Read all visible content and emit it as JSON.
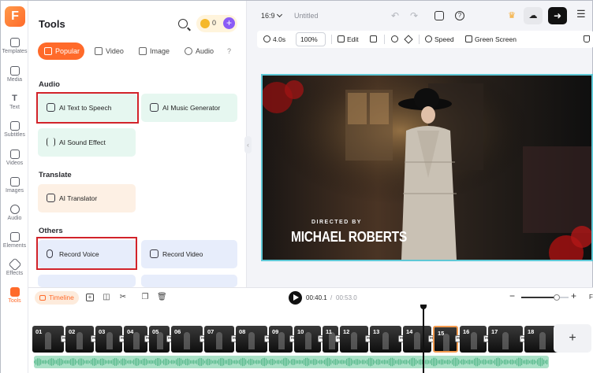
{
  "rail": {
    "logo": "F",
    "items": [
      {
        "label": "Templates",
        "icon": "templates-icon"
      },
      {
        "label": "Media",
        "icon": "media-icon"
      },
      {
        "label": "Text",
        "icon": "text-icon"
      },
      {
        "label": "Subtitles",
        "icon": "subtitles-icon"
      },
      {
        "label": "Videos",
        "icon": "videos-icon"
      },
      {
        "label": "Images",
        "icon": "images-icon"
      },
      {
        "label": "Audio",
        "icon": "audio-icon"
      },
      {
        "label": "Elements",
        "icon": "elements-icon"
      },
      {
        "label": "Effects",
        "icon": "effects-icon"
      },
      {
        "label": "Tools",
        "icon": "tools-icon",
        "active": true
      }
    ]
  },
  "panel": {
    "title": "Tools",
    "credits": "0",
    "tabs": [
      "Popular",
      "Video",
      "Image",
      "Audio",
      "?"
    ],
    "sections": {
      "audio": "Audio",
      "translate": "Translate",
      "others": "Others"
    },
    "cards": {
      "ai_tts": "AI Text to Speech",
      "ai_music": "AI Music Generator",
      "ai_sfx": "AI Sound Effect",
      "ai_translator": "AI Translator",
      "record_voice": "Record Voice",
      "record_video": "Record Video"
    }
  },
  "topbar": {
    "ratio": "16:9",
    "title": "Untitled"
  },
  "edit_toolbar": {
    "duration": "4.0s",
    "zoom": "100%",
    "edit": "Edit",
    "speed": "Speed",
    "green_screen": "Green Screen"
  },
  "preview": {
    "directed_by": "DIRECTED BY",
    "director": "MICHAEL ROBERTS"
  },
  "timeline": {
    "label": "Timeline",
    "current_time": "00:40.1",
    "separator": "/",
    "total_time": "00:53.0",
    "zoom_level": 0.75,
    "fit": "F",
    "clip_numbers": [
      "01",
      "02",
      "03",
      "04",
      "05",
      "06",
      "07",
      "08",
      "09",
      "10",
      "11",
      "12",
      "13",
      "14",
      "15",
      "16",
      "17",
      "18"
    ],
    "selected_clip": "15"
  },
  "colors": {
    "accent": "#ff6a2a",
    "highlight_frame": "#d2232a",
    "preview_border": "#5fc8d6"
  }
}
